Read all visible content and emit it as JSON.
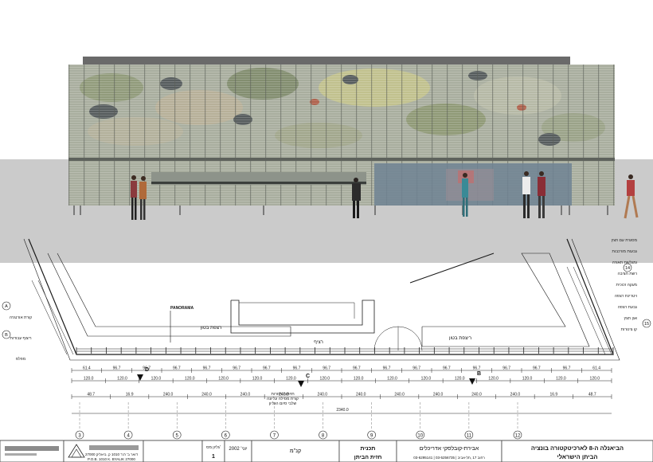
{
  "plan": {
    "panorama_label": "PANORAMA",
    "total_dimension": "2340.0",
    "module_dims_top": [
      "61.4",
      "96.7",
      "96.7",
      "96.7",
      "96.7",
      "96.7",
      "96.7",
      "96.7",
      "96.7",
      "96.7",
      "96.7",
      "96.7",
      "96.7",
      "96.7",
      "96.7",
      "96.7",
      "96.7",
      "61.4"
    ],
    "module_dims_mid": [
      "120.0",
      "120.0",
      "120.0",
      "120.0",
      "120.0",
      "120.0",
      "120.0",
      "120.0",
      "120.0",
      "120.0",
      "120.0",
      "120.0",
      "120.0",
      "120.0",
      "120.0",
      "120.0"
    ],
    "module_dims_low": [
      "48.7",
      "16.9",
      "240.0",
      "240.0",
      "240.0",
      "240.0",
      "240.0",
      "240.0",
      "240.0",
      "240.0",
      "240.0",
      "240.0",
      "16.9",
      "48.7"
    ],
    "grid_bubbles_bottom": [
      "3",
      "4",
      "5",
      "6",
      "7",
      "8",
      "9",
      "10",
      "11",
      "12"
    ],
    "grid_bubbles_left": [
      "A",
      "B"
    ],
    "grid_bubbles_right": [
      "14",
      "15"
    ],
    "section_marks": [
      "C",
      "B",
      "D"
    ],
    "room_labels": [
      "רצפת בטון",
      "רציף",
      "ריצפת בטון"
    ],
    "hebrew_notes_right": [
      "מסגרת עם חצץ",
      "גבעות מורכבות",
      "ומגלשת תאורה",
      "רשת חציבה",
      "מעקה זכוכית",
      "ויטרינת רצפה",
      "גבעת רצפה",
      "אגן חצץ",
      "קו צינורות"
    ],
    "hebrew_notes_left": [
      "קורת אורנגרה",
      "ריצוף עבודות",
      "מפלס"
    ],
    "hebrew_notes_bottom": [
      "חזיתות חוזרות",
      "קורת מסילה עליונה",
      "שלבי סיום הגליון"
    ]
  },
  "title_block": {
    "project_line1": "הביאנלה ה-8 לארכיטקטורה בונציה",
    "project_line2": "הביתן הישראלי",
    "architects": "אבירת-קובלסקי אדריכלים",
    "address_line": "03-6295141 | 03-5256735 | רחוב 17 ,תל-אביב",
    "drawing_title_1": "תכנית",
    "drawing_title_2": "חזית הביתן",
    "scale_label": "קנ\"מ",
    "date_label": "יוני' 2002",
    "sheet_label": "גליון מס'",
    "sheet_number": "1",
    "consultant_address": "P.O.B. 1010 K. BYALIK 27000",
    "consultant_address_he": "דואר ב' ת.ד 1010 ק. ביאליק 27000"
  },
  "colors": {
    "line": "#1a1a1a",
    "ground": "#c9c9c9",
    "glass": "#a7ad9b",
    "interior_blue": "#6d8294"
  }
}
